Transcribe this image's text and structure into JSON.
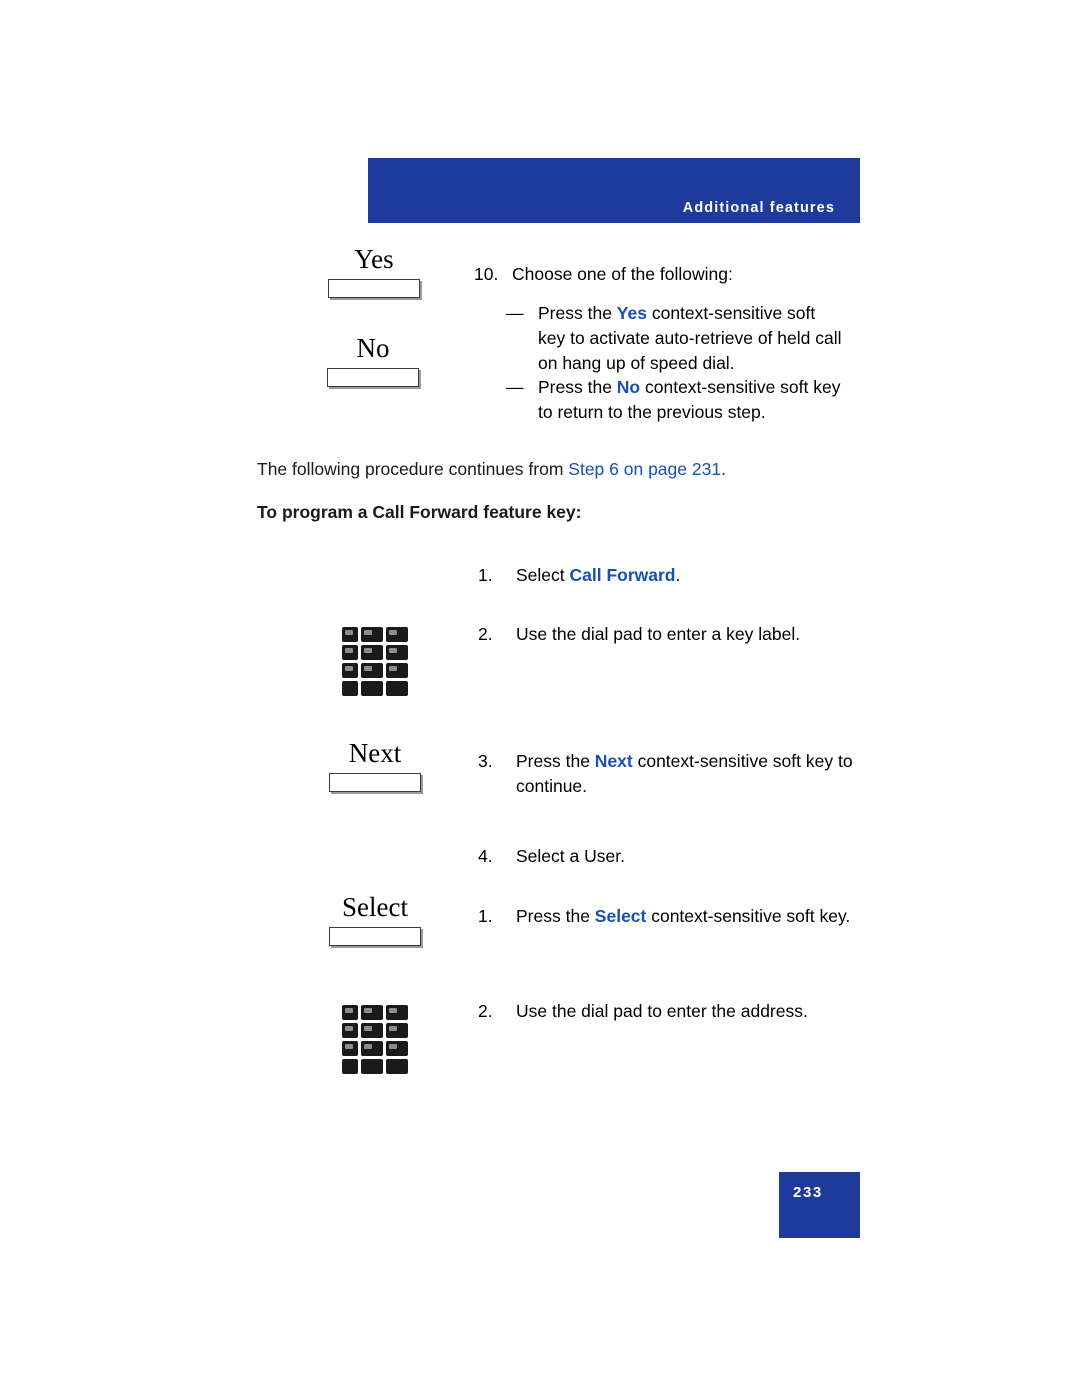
{
  "header": {
    "title": "Additional features"
  },
  "softkeys": {
    "yes": "Yes",
    "no": "No",
    "next": "Next",
    "select": "Select"
  },
  "steps": {
    "step10": {
      "num": "10.",
      "text": "Choose one of the following:"
    },
    "bullet1": {
      "mark": "—",
      "pre": "Press the ",
      "key": "Yes",
      "post": " context-sensitive soft key to activate auto-retrieve of held call on hang up of speed dial."
    },
    "bullet2": {
      "mark": "—",
      "pre": "Press the ",
      "key": "No",
      "post": " context-sensitive soft key to return to the previous step."
    }
  },
  "continuation": {
    "pre": "The following procedure continues from ",
    "link": "Step 6 on page 231",
    "post": "."
  },
  "section_title": "To program a Call Forward feature key:",
  "procedure": [
    {
      "num": "1.",
      "pre": "Select ",
      "key": "Call Forward",
      "post": "."
    },
    {
      "num": "2.",
      "pre": "Use the dial pad to enter a key label.",
      "key": "",
      "post": ""
    },
    {
      "num": "3.",
      "pre": "Press the ",
      "key": "Next",
      "post": " context-sensitive soft key to continue."
    },
    {
      "num": "4.",
      "pre": "Select a User.",
      "key": "",
      "post": ""
    },
    {
      "num": "1.",
      "pre": "Press the ",
      "key": "Select",
      "post": " context-sensitive soft key."
    },
    {
      "num": "2.",
      "pre": "Use the dial pad to enter the address.",
      "key": "",
      "post": ""
    }
  ],
  "page_number": "233"
}
